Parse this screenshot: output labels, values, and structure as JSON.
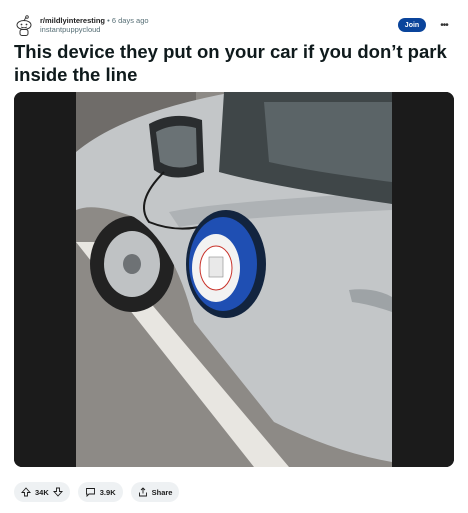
{
  "post": {
    "subreddit": "r/mildlyinteresting",
    "separator": "•",
    "age": "6 days ago",
    "author": "instantpuppycloud",
    "join_label": "Join",
    "more_label": "•••",
    "title": "This device they put on your car if you don’t park inside the line"
  },
  "actions": {
    "votes": "34K",
    "comments": "3.9K",
    "share_label": "Share"
  },
  "icons": {
    "avatar": "reddit-snoo-icon",
    "upvote": "upvote-arrow-icon",
    "downvote": "downvote-arrow-icon",
    "comment": "comment-bubble-icon",
    "share": "share-icon",
    "more": "more-options-icon"
  },
  "colors": {
    "join_button": "#0a449b",
    "pill_background": "#eef1f3",
    "device_blue": "#1f4fb3"
  }
}
